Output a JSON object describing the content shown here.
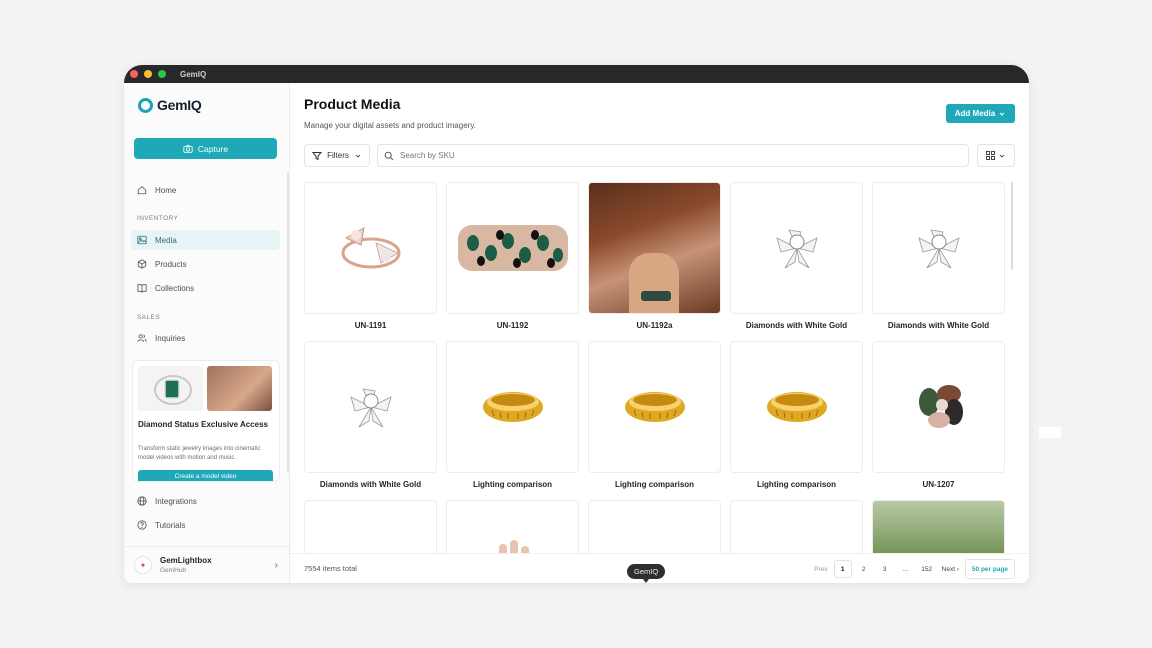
{
  "window": {
    "title": "GemIQ"
  },
  "sidebar": {
    "logo": "GemIQ",
    "capture_label": "Capture",
    "home": "Home",
    "section_inventory": "INVENTORY",
    "media": "Media",
    "products": "Products",
    "collections": "Collections",
    "section_sales": "SALES",
    "inquiries": "Inquiries",
    "promo": {
      "title": "Diamond Status Exclusive Access",
      "desc": "Transform static jewelry images into cinematic model videos with motion and music.",
      "button": "Create a model video"
    },
    "integrations": "Integrations",
    "tutorials": "Tutorials",
    "account": {
      "name": "GemLightbox",
      "org": "GemHub"
    }
  },
  "main": {
    "title": "Product Media",
    "subtitle": "Manage your digital assets and product imagery.",
    "add_media": "Add Media",
    "filters": "Filters",
    "search_placeholder": "Search by SKU",
    "items": [
      {
        "caption": "UN-1191",
        "kind": "ring-rose"
      },
      {
        "caption": "UN-1192",
        "kind": "bracelet"
      },
      {
        "caption": "UN-1192a",
        "kind": "model"
      },
      {
        "caption": "Diamonds with White Gold",
        "kind": "brooch"
      },
      {
        "caption": "Diamonds with White Gold",
        "kind": "brooch"
      },
      {
        "caption": "Diamonds with White Gold",
        "kind": "brooch"
      },
      {
        "caption": "Lighting comparison",
        "kind": "gold-band"
      },
      {
        "caption": "Lighting comparison",
        "kind": "gold-band"
      },
      {
        "caption": "Lighting comparison",
        "kind": "gold-band"
      },
      {
        "caption": "UN-1207",
        "kind": "cluster-ring"
      },
      {
        "caption": "",
        "kind": "empty"
      },
      {
        "caption": "",
        "kind": "hand"
      },
      {
        "caption": "",
        "kind": "wrist"
      },
      {
        "caption": "",
        "kind": "chain"
      },
      {
        "caption": "",
        "kind": "grass"
      }
    ],
    "total": "7554 items total",
    "pager": {
      "prev": "Prev",
      "p1": "1",
      "p2": "2",
      "p3": "3",
      "ellipsis": "...",
      "last": "152",
      "next": "Next",
      "per_page": "50 per page"
    },
    "tooltip": "GemIQ"
  },
  "colors": {
    "accent": "#1fa8b8",
    "titlebar": "#262829"
  }
}
